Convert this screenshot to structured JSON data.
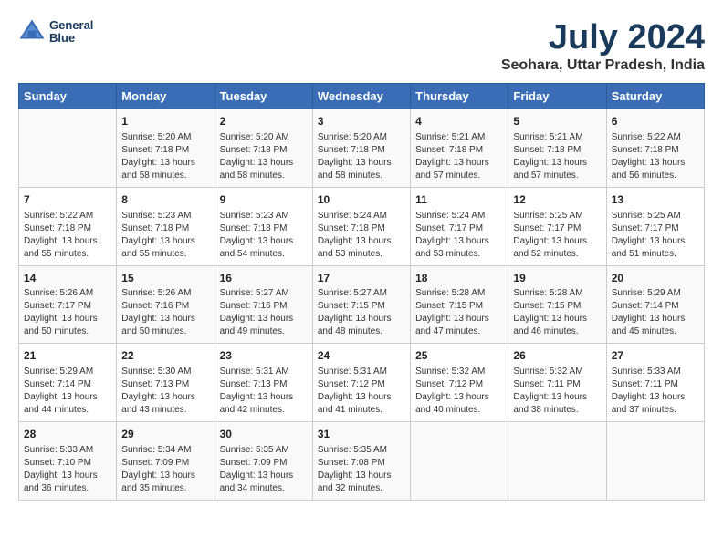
{
  "logo": {
    "line1": "General",
    "line2": "Blue"
  },
  "title": "July 2024",
  "subtitle": "Seohara, Uttar Pradesh, India",
  "days_of_week": [
    "Sunday",
    "Monday",
    "Tuesday",
    "Wednesday",
    "Thursday",
    "Friday",
    "Saturday"
  ],
  "weeks": [
    [
      {
        "day": "",
        "info": ""
      },
      {
        "day": "1",
        "info": "Sunrise: 5:20 AM\nSunset: 7:18 PM\nDaylight: 13 hours\nand 58 minutes."
      },
      {
        "day": "2",
        "info": "Sunrise: 5:20 AM\nSunset: 7:18 PM\nDaylight: 13 hours\nand 58 minutes."
      },
      {
        "day": "3",
        "info": "Sunrise: 5:20 AM\nSunset: 7:18 PM\nDaylight: 13 hours\nand 58 minutes."
      },
      {
        "day": "4",
        "info": "Sunrise: 5:21 AM\nSunset: 7:18 PM\nDaylight: 13 hours\nand 57 minutes."
      },
      {
        "day": "5",
        "info": "Sunrise: 5:21 AM\nSunset: 7:18 PM\nDaylight: 13 hours\nand 57 minutes."
      },
      {
        "day": "6",
        "info": "Sunrise: 5:22 AM\nSunset: 7:18 PM\nDaylight: 13 hours\nand 56 minutes."
      }
    ],
    [
      {
        "day": "7",
        "info": "Sunrise: 5:22 AM\nSunset: 7:18 PM\nDaylight: 13 hours\nand 55 minutes."
      },
      {
        "day": "8",
        "info": "Sunrise: 5:23 AM\nSunset: 7:18 PM\nDaylight: 13 hours\nand 55 minutes."
      },
      {
        "day": "9",
        "info": "Sunrise: 5:23 AM\nSunset: 7:18 PM\nDaylight: 13 hours\nand 54 minutes."
      },
      {
        "day": "10",
        "info": "Sunrise: 5:24 AM\nSunset: 7:18 PM\nDaylight: 13 hours\nand 53 minutes."
      },
      {
        "day": "11",
        "info": "Sunrise: 5:24 AM\nSunset: 7:17 PM\nDaylight: 13 hours\nand 53 minutes."
      },
      {
        "day": "12",
        "info": "Sunrise: 5:25 AM\nSunset: 7:17 PM\nDaylight: 13 hours\nand 52 minutes."
      },
      {
        "day": "13",
        "info": "Sunrise: 5:25 AM\nSunset: 7:17 PM\nDaylight: 13 hours\nand 51 minutes."
      }
    ],
    [
      {
        "day": "14",
        "info": "Sunrise: 5:26 AM\nSunset: 7:17 PM\nDaylight: 13 hours\nand 50 minutes."
      },
      {
        "day": "15",
        "info": "Sunrise: 5:26 AM\nSunset: 7:16 PM\nDaylight: 13 hours\nand 50 minutes."
      },
      {
        "day": "16",
        "info": "Sunrise: 5:27 AM\nSunset: 7:16 PM\nDaylight: 13 hours\nand 49 minutes."
      },
      {
        "day": "17",
        "info": "Sunrise: 5:27 AM\nSunset: 7:15 PM\nDaylight: 13 hours\nand 48 minutes."
      },
      {
        "day": "18",
        "info": "Sunrise: 5:28 AM\nSunset: 7:15 PM\nDaylight: 13 hours\nand 47 minutes."
      },
      {
        "day": "19",
        "info": "Sunrise: 5:28 AM\nSunset: 7:15 PM\nDaylight: 13 hours\nand 46 minutes."
      },
      {
        "day": "20",
        "info": "Sunrise: 5:29 AM\nSunset: 7:14 PM\nDaylight: 13 hours\nand 45 minutes."
      }
    ],
    [
      {
        "day": "21",
        "info": "Sunrise: 5:29 AM\nSunset: 7:14 PM\nDaylight: 13 hours\nand 44 minutes."
      },
      {
        "day": "22",
        "info": "Sunrise: 5:30 AM\nSunset: 7:13 PM\nDaylight: 13 hours\nand 43 minutes."
      },
      {
        "day": "23",
        "info": "Sunrise: 5:31 AM\nSunset: 7:13 PM\nDaylight: 13 hours\nand 42 minutes."
      },
      {
        "day": "24",
        "info": "Sunrise: 5:31 AM\nSunset: 7:12 PM\nDaylight: 13 hours\nand 41 minutes."
      },
      {
        "day": "25",
        "info": "Sunrise: 5:32 AM\nSunset: 7:12 PM\nDaylight: 13 hours\nand 40 minutes."
      },
      {
        "day": "26",
        "info": "Sunrise: 5:32 AM\nSunset: 7:11 PM\nDaylight: 13 hours\nand 38 minutes."
      },
      {
        "day": "27",
        "info": "Sunrise: 5:33 AM\nSunset: 7:11 PM\nDaylight: 13 hours\nand 37 minutes."
      }
    ],
    [
      {
        "day": "28",
        "info": "Sunrise: 5:33 AM\nSunset: 7:10 PM\nDaylight: 13 hours\nand 36 minutes."
      },
      {
        "day": "29",
        "info": "Sunrise: 5:34 AM\nSunset: 7:09 PM\nDaylight: 13 hours\nand 35 minutes."
      },
      {
        "day": "30",
        "info": "Sunrise: 5:35 AM\nSunset: 7:09 PM\nDaylight: 13 hours\nand 34 minutes."
      },
      {
        "day": "31",
        "info": "Sunrise: 5:35 AM\nSunset: 7:08 PM\nDaylight: 13 hours\nand 32 minutes."
      },
      {
        "day": "",
        "info": ""
      },
      {
        "day": "",
        "info": ""
      },
      {
        "day": "",
        "info": ""
      }
    ]
  ]
}
